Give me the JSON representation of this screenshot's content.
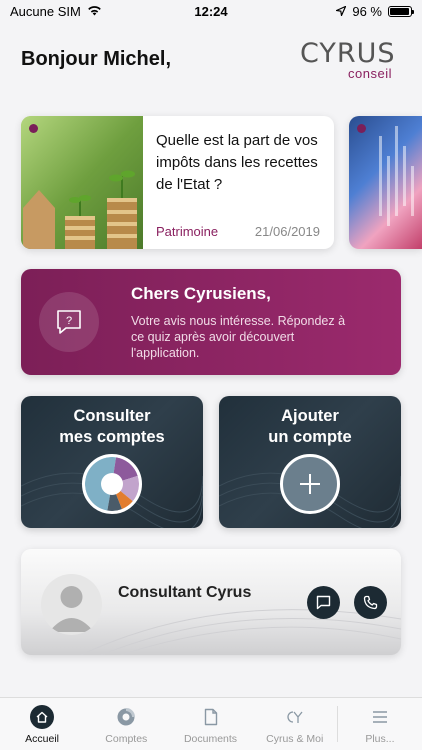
{
  "status_bar": {
    "carrier": "Aucune SIM",
    "time": "12:24",
    "battery_percent": "96 %",
    "battery_level": 0.96
  },
  "header": {
    "greeting": "Bonjour Michel,",
    "logo_main": "CYRUS",
    "logo_sub": "conseil"
  },
  "article": {
    "title": "Quelle est la part de vos impôts dans les recettes de l'Etat ?",
    "category": "Patrimoine",
    "date": "21/06/2019"
  },
  "quiz": {
    "title": "Chers Cyrusiens,",
    "description": "Votre avis nous intéresse. Répondez à ce quiz après avoir découvert l'application."
  },
  "tiles": {
    "accounts_line1": "Consulter",
    "accounts_line2": "mes comptes",
    "add_line1": "Ajouter",
    "add_line2": "un compte"
  },
  "consultant": {
    "name": "Consultant Cyrus"
  },
  "tab_bar": {
    "items": [
      {
        "label": "Accueil",
        "icon": "home-icon"
      },
      {
        "label": "Comptes",
        "icon": "donut-chart-icon"
      },
      {
        "label": "Documents",
        "icon": "document-icon"
      },
      {
        "label": "Cyrus & Moi",
        "icon": "cyrus-logo-icon"
      },
      {
        "label": "Plus...",
        "icon": "menu-icon"
      }
    ]
  },
  "colors": {
    "brand": "#8a2160",
    "dark_tile": "#21303b",
    "background": "#f4f4f6"
  }
}
